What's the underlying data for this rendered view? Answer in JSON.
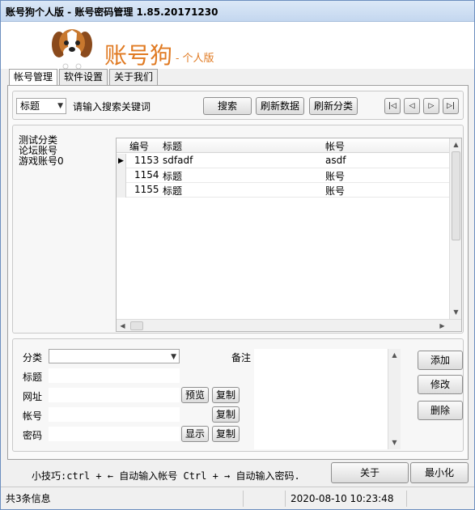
{
  "window": {
    "title": "账号狗个人版 - 账号密码管理 1.85.20171230"
  },
  "header": {
    "brand": "账号狗",
    "subtitle": "- 个人版"
  },
  "tabs": [
    {
      "label": "帐号管理"
    },
    {
      "label": "软件设置"
    },
    {
      "label": "关于我们"
    }
  ],
  "search": {
    "field_select": "标题",
    "placeholder": "请输入搜索关键词",
    "search_button": "搜索",
    "refresh_data_button": "刷新数据",
    "refresh_category_button": "刷新分类"
  },
  "nav": {
    "first": "|◁",
    "prev": "◁",
    "next": "▷",
    "last": "▷|"
  },
  "categories": [
    "测试分类",
    "论坛账号",
    "游戏账号0"
  ],
  "table": {
    "columns": [
      "编号",
      "标题",
      "帐号"
    ],
    "rows": [
      {
        "id": "1153",
        "title": "sdfadf",
        "account": "asdf",
        "current": true
      },
      {
        "id": "1154",
        "title": "标题",
        "account": "账号",
        "current": false
      },
      {
        "id": "1155",
        "title": "标题",
        "account": "账号",
        "current": false
      }
    ]
  },
  "detail": {
    "category_label": "分类",
    "title_label": "标题",
    "url_label": "网址",
    "account_label": "帐号",
    "password_label": "密码",
    "notes_label": "备注",
    "preview_button": "预览",
    "copy_button": "复制",
    "show_button": "显示",
    "add_button": "添加",
    "edit_button": "修改",
    "delete_button": "删除"
  },
  "footer": {
    "tip": "小技巧:ctrl + ← 自动输入帐号 Ctrl + → 自动输入密码.",
    "about_button": "关于",
    "minimize_button": "最小化"
  },
  "status": {
    "count": "共3条信息",
    "datetime": "2020-08-10 10:23:48"
  },
  "colors": {
    "brand": "#e07a22",
    "window_border": "#6d8fbf"
  }
}
